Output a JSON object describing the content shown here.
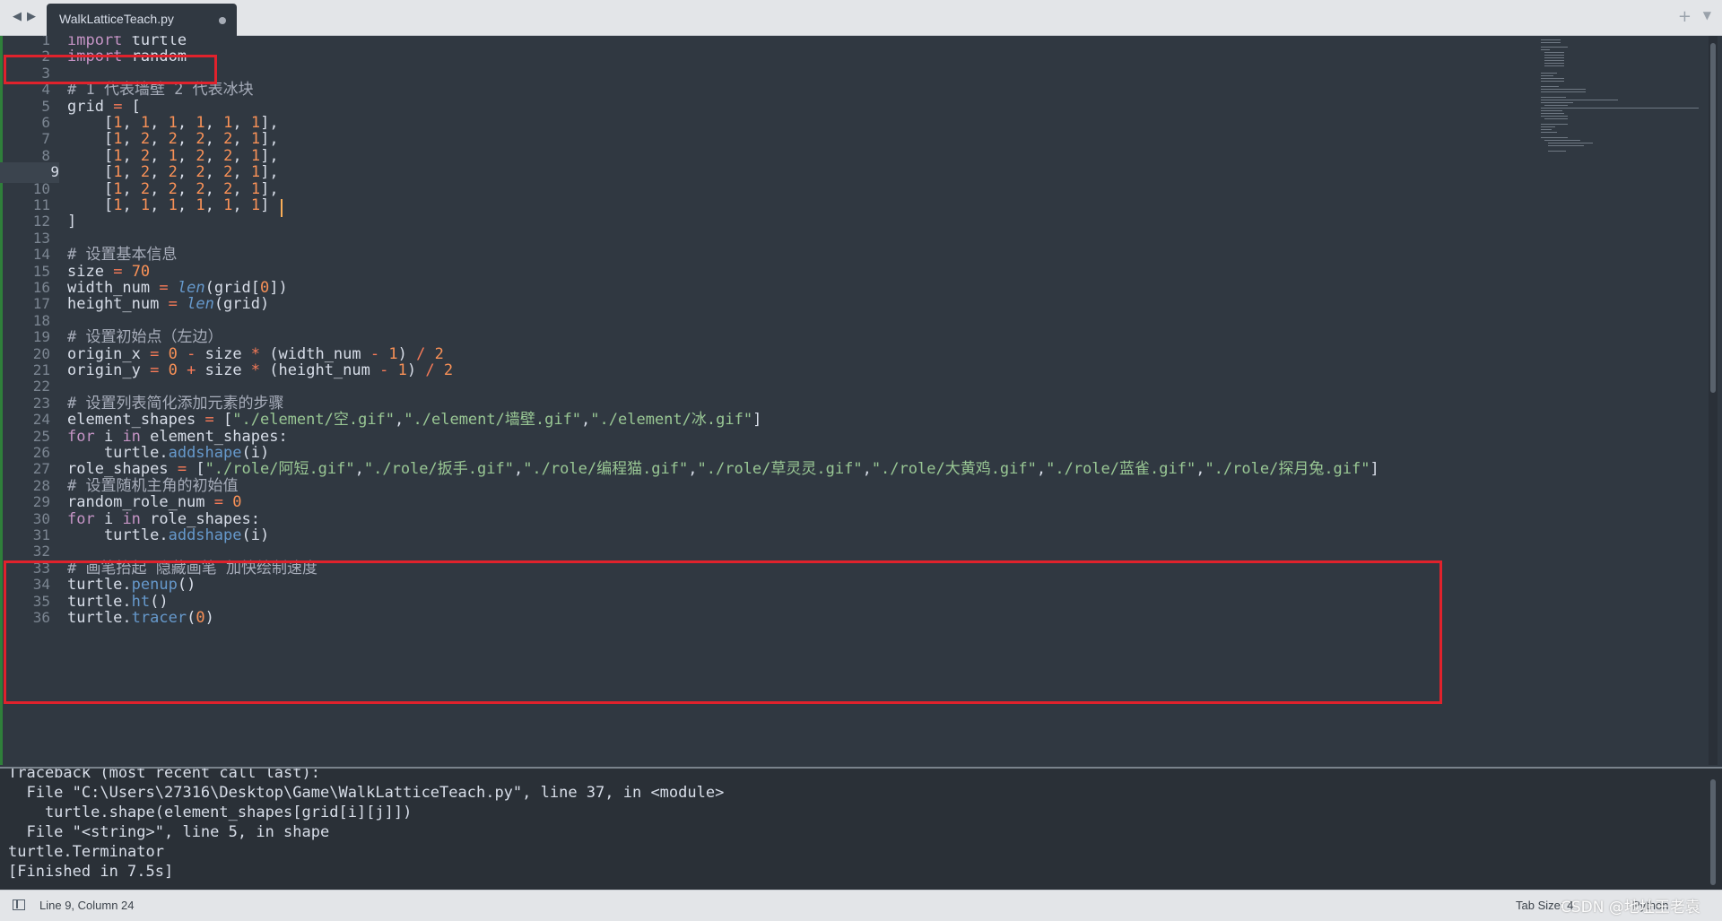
{
  "tabbar": {
    "back_icon": "◀",
    "forward_icon": "▶",
    "tab_title": "WalkLatticeTeach.py",
    "add_icon": "+",
    "more_icon": "▼"
  },
  "editor": {
    "line_numbers": [
      "1",
      "2",
      "3",
      "4",
      "5",
      "6",
      "7",
      "8",
      "9",
      "10",
      "11",
      "12",
      "13",
      "14",
      "15",
      "16",
      "17",
      "18",
      "19",
      "20",
      "21",
      "22",
      "23",
      "24",
      "25",
      "26",
      "27",
      "28",
      "29",
      "30",
      "31",
      "32",
      "33",
      "34",
      "35",
      "36"
    ],
    "active_line": 9,
    "lines": [
      [
        [
          "kw",
          "import"
        ],
        [
          "plain",
          " turtle"
        ]
      ],
      [
        [
          "kw",
          "import"
        ],
        [
          "plain",
          " random"
        ]
      ],
      [],
      [
        [
          "cmt",
          "# 1 代表墙壁 2 代表冰块"
        ]
      ],
      [
        [
          "plain",
          "grid "
        ],
        [
          "op",
          "="
        ],
        [
          "plain",
          " ["
        ]
      ],
      [
        [
          "plain",
          "    ["
        ],
        [
          "num",
          "1"
        ],
        [
          "plain",
          ", "
        ],
        [
          "num",
          "1"
        ],
        [
          "plain",
          ", "
        ],
        [
          "num",
          "1"
        ],
        [
          "plain",
          ", "
        ],
        [
          "num",
          "1"
        ],
        [
          "plain",
          ", "
        ],
        [
          "num",
          "1"
        ],
        [
          "plain",
          ", "
        ],
        [
          "num",
          "1"
        ],
        [
          "plain",
          "],"
        ]
      ],
      [
        [
          "plain",
          "    ["
        ],
        [
          "num",
          "1"
        ],
        [
          "plain",
          ", "
        ],
        [
          "num",
          "2"
        ],
        [
          "plain",
          ", "
        ],
        [
          "num",
          "2"
        ],
        [
          "plain",
          ", "
        ],
        [
          "num",
          "2"
        ],
        [
          "plain",
          ", "
        ],
        [
          "num",
          "2"
        ],
        [
          "plain",
          ", "
        ],
        [
          "num",
          "1"
        ],
        [
          "plain",
          "],"
        ]
      ],
      [
        [
          "plain",
          "    ["
        ],
        [
          "num",
          "1"
        ],
        [
          "plain",
          ", "
        ],
        [
          "num",
          "2"
        ],
        [
          "plain",
          ", "
        ],
        [
          "num",
          "1"
        ],
        [
          "plain",
          ", "
        ],
        [
          "num",
          "2"
        ],
        [
          "plain",
          ", "
        ],
        [
          "num",
          "2"
        ],
        [
          "plain",
          ", "
        ],
        [
          "num",
          "1"
        ],
        [
          "plain",
          "],"
        ]
      ],
      [
        [
          "plain",
          "    ["
        ],
        [
          "num",
          "1"
        ],
        [
          "plain",
          ", "
        ],
        [
          "num",
          "2"
        ],
        [
          "plain",
          ", "
        ],
        [
          "num",
          "2"
        ],
        [
          "plain",
          ", "
        ],
        [
          "num",
          "2"
        ],
        [
          "plain",
          ", "
        ],
        [
          "num",
          "2"
        ],
        [
          "plain",
          ", "
        ],
        [
          "num",
          "1"
        ],
        [
          "plain",
          "],"
        ]
      ],
      [
        [
          "plain",
          "    ["
        ],
        [
          "num",
          "1"
        ],
        [
          "plain",
          ", "
        ],
        [
          "num",
          "2"
        ],
        [
          "plain",
          ", "
        ],
        [
          "num",
          "2"
        ],
        [
          "plain",
          ", "
        ],
        [
          "num",
          "2"
        ],
        [
          "plain",
          ", "
        ],
        [
          "num",
          "2"
        ],
        [
          "plain",
          ", "
        ],
        [
          "num",
          "1"
        ],
        [
          "plain",
          "],"
        ]
      ],
      [
        [
          "plain",
          "    ["
        ],
        [
          "num",
          "1"
        ],
        [
          "plain",
          ", "
        ],
        [
          "num",
          "1"
        ],
        [
          "plain",
          ", "
        ],
        [
          "num",
          "1"
        ],
        [
          "plain",
          ", "
        ],
        [
          "num",
          "1"
        ],
        [
          "plain",
          ", "
        ],
        [
          "num",
          "1"
        ],
        [
          "plain",
          ", "
        ],
        [
          "num",
          "1"
        ],
        [
          "plain",
          "]"
        ]
      ],
      [
        [
          "plain",
          "]"
        ]
      ],
      [],
      [
        [
          "cmt",
          "# 设置基本信息"
        ]
      ],
      [
        [
          "plain",
          "size "
        ],
        [
          "op",
          "="
        ],
        [
          "plain",
          " "
        ],
        [
          "num",
          "70"
        ]
      ],
      [
        [
          "plain",
          "width_num "
        ],
        [
          "op",
          "="
        ],
        [
          "plain",
          " "
        ],
        [
          "fn",
          "len"
        ],
        [
          "plain",
          "(grid["
        ],
        [
          "num",
          "0"
        ],
        [
          "plain",
          "])"
        ]
      ],
      [
        [
          "plain",
          "height_num "
        ],
        [
          "op",
          "="
        ],
        [
          "plain",
          " "
        ],
        [
          "fn",
          "len"
        ],
        [
          "plain",
          "(grid)"
        ]
      ],
      [],
      [
        [
          "cmt",
          "# 设置初始点（左边）"
        ]
      ],
      [
        [
          "plain",
          "origin_x "
        ],
        [
          "op",
          "="
        ],
        [
          "plain",
          " "
        ],
        [
          "num",
          "0"
        ],
        [
          "plain",
          " "
        ],
        [
          "op",
          "-"
        ],
        [
          "plain",
          " size "
        ],
        [
          "op",
          "*"
        ],
        [
          "plain",
          " (width_num "
        ],
        [
          "op",
          "-"
        ],
        [
          "plain",
          " "
        ],
        [
          "num",
          "1"
        ],
        [
          "plain",
          ") "
        ],
        [
          "op",
          "/"
        ],
        [
          "plain",
          " "
        ],
        [
          "num",
          "2"
        ]
      ],
      [
        [
          "plain",
          "origin_y "
        ],
        [
          "op",
          "="
        ],
        [
          "plain",
          " "
        ],
        [
          "num",
          "0"
        ],
        [
          "plain",
          " "
        ],
        [
          "op",
          "+"
        ],
        [
          "plain",
          " size "
        ],
        [
          "op",
          "*"
        ],
        [
          "plain",
          " (height_num "
        ],
        [
          "op",
          "-"
        ],
        [
          "plain",
          " "
        ],
        [
          "num",
          "1"
        ],
        [
          "plain",
          ") "
        ],
        [
          "op",
          "/"
        ],
        [
          "plain",
          " "
        ],
        [
          "num",
          "2"
        ]
      ],
      [],
      [
        [
          "cmt",
          "# 设置列表简化添加元素的步骤"
        ]
      ],
      [
        [
          "plain",
          "element_shapes "
        ],
        [
          "op",
          "="
        ],
        [
          "plain",
          " ["
        ],
        [
          "str",
          "\"./element/空.gif\""
        ],
        [
          "plain",
          ","
        ],
        [
          "str",
          "\"./element/墙壁.gif\""
        ],
        [
          "plain",
          ","
        ],
        [
          "str",
          "\"./element/冰.gif\""
        ],
        [
          "plain",
          "]"
        ]
      ],
      [
        [
          "kw",
          "for"
        ],
        [
          "plain",
          " i "
        ],
        [
          "kw",
          "in"
        ],
        [
          "plain",
          " element_shapes:"
        ]
      ],
      [
        [
          "plain",
          "    turtle."
        ],
        [
          "attr",
          "addshape"
        ],
        [
          "plain",
          "(i)"
        ]
      ],
      [
        [
          "plain",
          "role_shapes "
        ],
        [
          "op",
          "="
        ],
        [
          "plain",
          " ["
        ],
        [
          "str",
          "\"./role/阿短.gif\""
        ],
        [
          "plain",
          ","
        ],
        [
          "str",
          "\"./role/扳手.gif\""
        ],
        [
          "plain",
          ","
        ],
        [
          "str",
          "\"./role/编程猫.gif\""
        ],
        [
          "plain",
          ","
        ],
        [
          "str",
          "\"./role/草灵灵.gif\""
        ],
        [
          "plain",
          ","
        ],
        [
          "str",
          "\"./role/大黄鸡.gif\""
        ],
        [
          "plain",
          ","
        ],
        [
          "str",
          "\"./role/蓝雀.gif\""
        ],
        [
          "plain",
          ","
        ],
        [
          "str",
          "\"./role/探月兔.gif\""
        ],
        [
          "plain",
          "]"
        ]
      ],
      [
        [
          "cmt",
          "# 设置随机主角的初始值"
        ]
      ],
      [
        [
          "plain",
          "random_role_num "
        ],
        [
          "op",
          "="
        ],
        [
          "plain",
          " "
        ],
        [
          "num",
          "0"
        ]
      ],
      [
        [
          "kw",
          "for"
        ],
        [
          "plain",
          " i "
        ],
        [
          "kw",
          "in"
        ],
        [
          "plain",
          " role_shapes:"
        ]
      ],
      [
        [
          "plain",
          "    turtle."
        ],
        [
          "attr",
          "addshape"
        ],
        [
          "plain",
          "(i)"
        ]
      ],
      [],
      [
        [
          "cmt",
          "# 画笔抬起 隐藏画笔 加快绘制速度"
        ]
      ],
      [
        [
          "plain",
          "turtle."
        ],
        [
          "attr",
          "penup"
        ],
        [
          "plain",
          "()"
        ]
      ],
      [
        [
          "plain",
          "turtle."
        ],
        [
          "attr",
          "ht"
        ],
        [
          "plain",
          "()"
        ]
      ],
      [
        [
          "plain",
          "turtle."
        ],
        [
          "attr",
          "tracer"
        ],
        [
          "plain",
          "("
        ],
        [
          "num",
          "0"
        ],
        [
          "plain",
          ")"
        ]
      ]
    ]
  },
  "output": {
    "lines": [
      "Traceback (most recent call last):",
      "  File \"C:\\Users\\27316\\Desktop\\Game\\WalkLatticeTeach.py\", line 37, in <module>",
      "    turtle.shape(element_shapes[grid[i][j]])",
      "  File \"<string>\", line 5, in shape",
      "turtle.Terminator",
      "[Finished in 7.5s]"
    ]
  },
  "statusbar": {
    "position": "Line 9, Column 24",
    "tab_size": "Tab Size: 4",
    "syntax": "Python",
    "watermark": "CSDN @地址王老袁"
  },
  "colors": {
    "background": "#303841",
    "highlight_box": "#e0222c",
    "caret": "#f9ae58"
  }
}
